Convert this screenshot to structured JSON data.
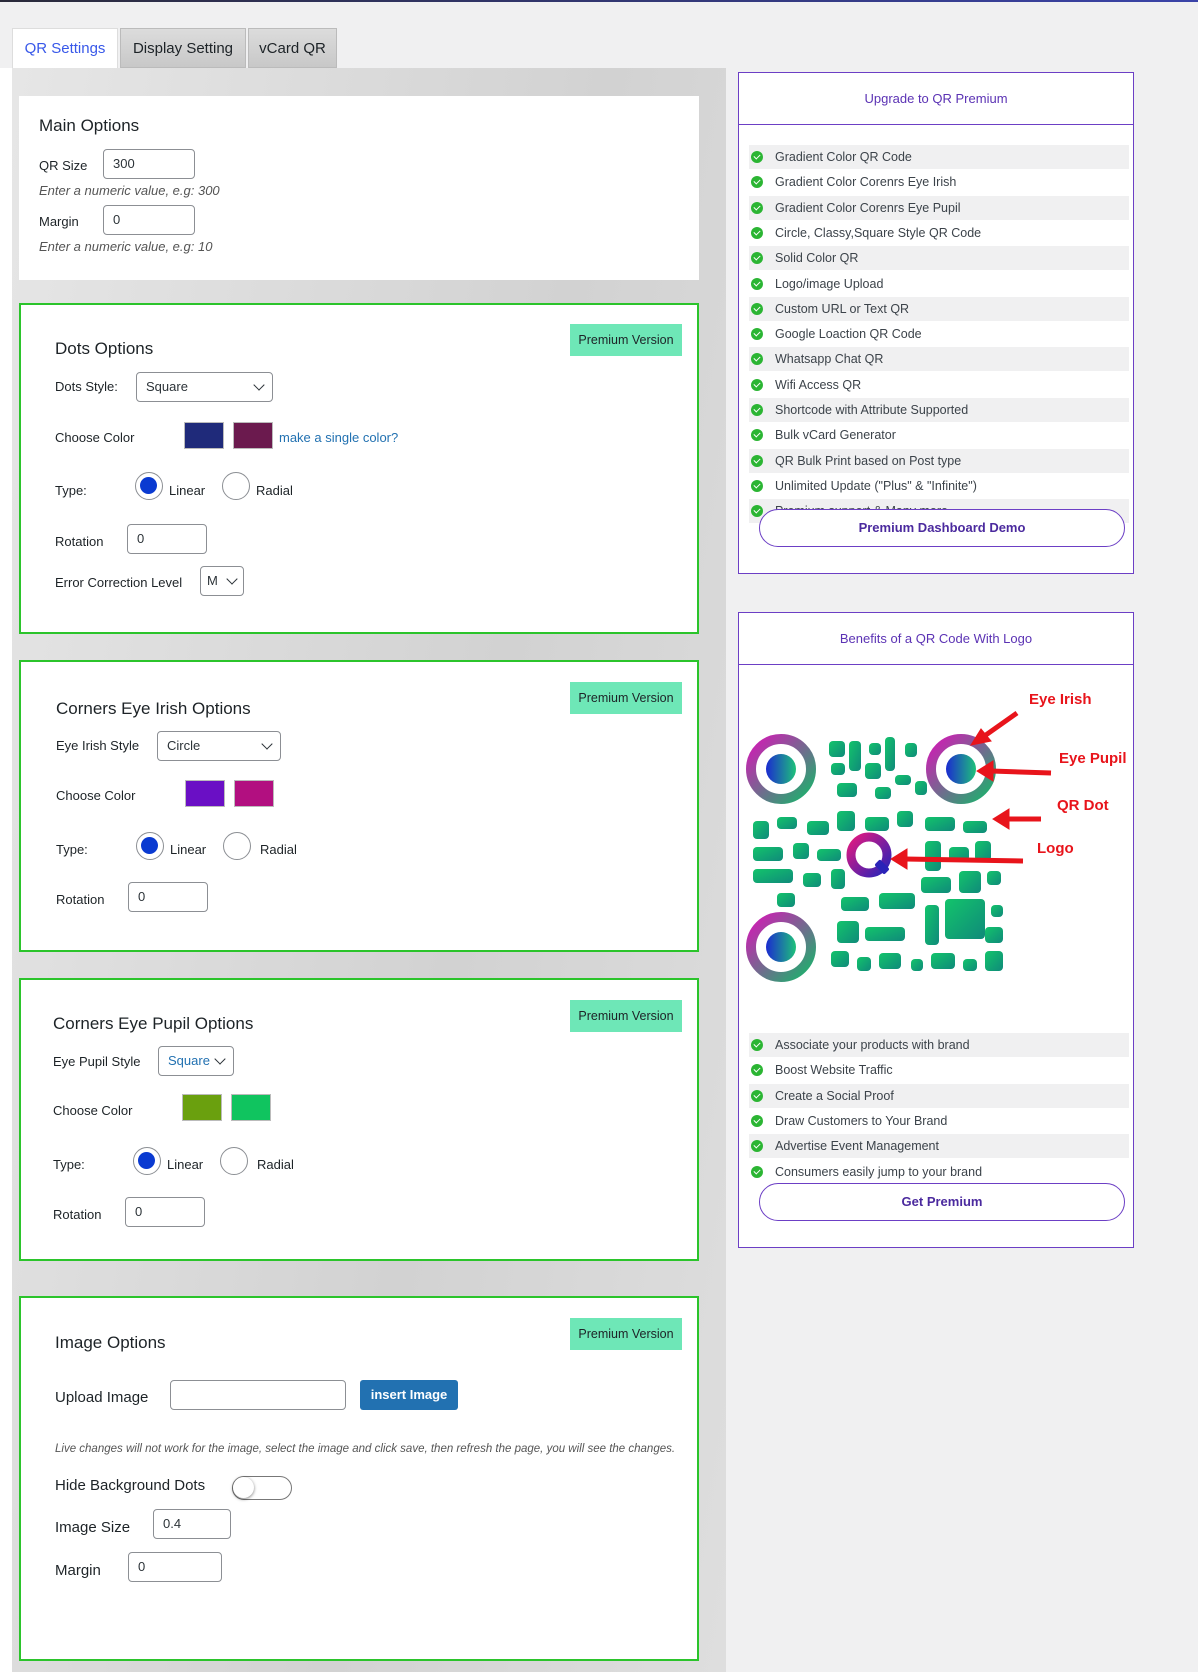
{
  "tabs": [
    "QR Settings",
    "Display Setting",
    "vCard QR"
  ],
  "premium_badge": "Premium Version",
  "main_options": {
    "title": "Main Options",
    "qr_size_label": "QR Size",
    "qr_size_value": "300",
    "qr_size_hint": "Enter a numeric value, e.g: 300",
    "margin_label": "Margin",
    "margin_value": "0",
    "margin_hint": "Enter a numeric value, e.g: 10"
  },
  "dots_options": {
    "title": "Dots Options",
    "style_label": "Dots Style:",
    "style_value": "Square",
    "color_label": "Choose Color",
    "color1": "#1f2a7a",
    "color2": "#6b1a4e",
    "single_color_link": "make a single color?",
    "type_label": "Type:",
    "linear_label": "Linear",
    "radial_label": "Radial",
    "rotation_label": "Rotation",
    "rotation_value": "0",
    "ecl_label": "Error Correction Level",
    "ecl_value": "M"
  },
  "eye_irish_options": {
    "title": "Corners Eye Irish Options",
    "style_label": "Eye Irish Style",
    "style_value": "Circle",
    "color_label": "Choose Color",
    "color1": "#6a0fc5",
    "color2": "#b20f80",
    "type_label": "Type:",
    "linear_label": "Linear",
    "radial_label": "Radial",
    "rotation_label": "Rotation",
    "rotation_value": "0"
  },
  "eye_pupil_options": {
    "title": "Corners Eye Pupil Options",
    "style_label": "Eye Pupil Style",
    "style_value": "Square",
    "color_label": "Choose Color",
    "color1": "#6aa00e",
    "color2": "#10c45f",
    "type_label": "Type:",
    "linear_label": "Linear",
    "radial_label": "Radial",
    "rotation_label": "Rotation",
    "rotation_value": "0"
  },
  "image_options": {
    "title": "Image Options",
    "upload_label": "Upload Image",
    "insert_button": "insert Image",
    "note": "Live changes will not work for the image, select the image and click save, then refresh the page, you will see the changes.",
    "hide_bg_label": "Hide Background Dots",
    "image_size_label": "Image Size",
    "image_size_value": "0.4",
    "margin_label": "Margin",
    "margin_value": "0"
  },
  "upgrade_box": {
    "title": "Upgrade to QR Premium",
    "features": [
      "Gradient Color QR Code",
      "Gradient Color Corenrs Eye Irish",
      "Gradient Color Corenrs Eye Pupil",
      "Circle, Classy,Square Style QR Code",
      "Solid Color QR",
      "Logo/image Upload",
      "Custom URL or Text QR",
      "Google Loaction QR Code",
      "Whatsapp Chat QR",
      "Wifi Access QR",
      "Shortcode with Attribute Supported",
      "Bulk vCard Generator",
      "QR Bulk Print based on Post type",
      "Unlimited Update (\"Plus\" & \"Infinite\")",
      "Premium support & Many more"
    ],
    "button": "Premium Dashboard Demo"
  },
  "benefits_box": {
    "title": "Benefits of a QR Code With Logo",
    "annotations": [
      "Eye Irish",
      "Eye Pupil",
      "QR Dot",
      "Logo"
    ],
    "benefits": [
      "Associate your products with brand",
      "Boost Website Traffic",
      "Create a Social Proof",
      "Draw Customers to Your Brand",
      "Advertise Event Management",
      "Consumers easily jump to your brand"
    ],
    "button": "Get Premium"
  }
}
